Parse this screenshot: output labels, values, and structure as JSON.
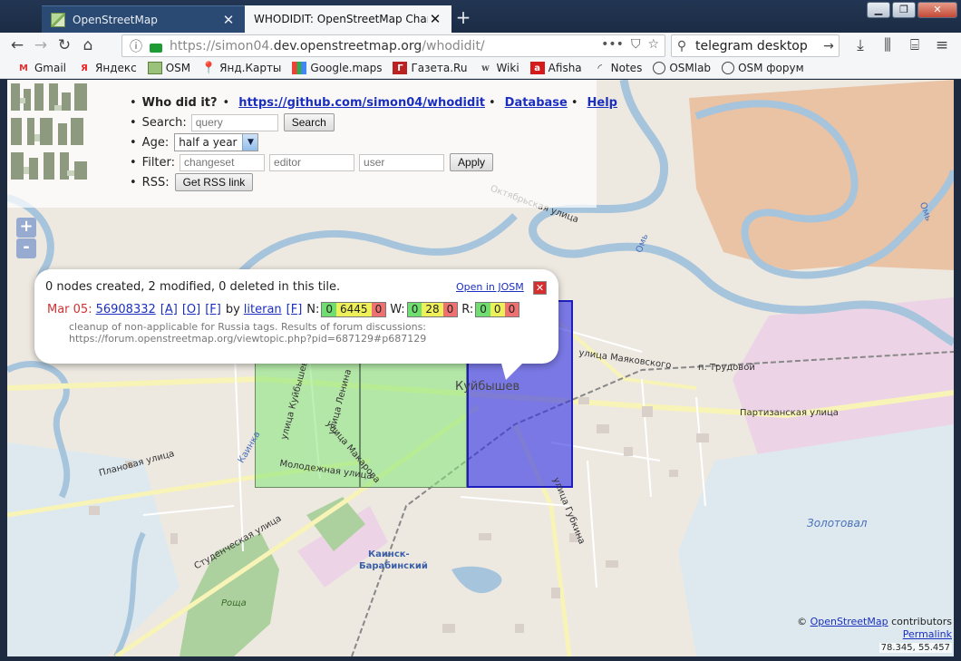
{
  "browser": {
    "tabs": [
      {
        "title": "OpenStreetMap",
        "active": false
      },
      {
        "title": "WHODIDIT: OpenStreetMap Chang",
        "active": true
      }
    ],
    "url": {
      "prefix": "https://simon04.",
      "host": "dev.openstreetmap.org",
      "path": "/whodidit/"
    },
    "search_query": "telegram desktop",
    "bookmarks": [
      {
        "label": "Gmail",
        "icon": "gmail-icon"
      },
      {
        "label": "Яндекс",
        "icon": "yandex-icon"
      },
      {
        "label": "OSM",
        "icon": "osm-icon"
      },
      {
        "label": "Янд.Карты",
        "icon": "map-pin-icon"
      },
      {
        "label": "Google.maps",
        "icon": "google-maps-icon"
      },
      {
        "label": "Газета.Ru",
        "icon": "gazeta-icon"
      },
      {
        "label": "Wiki",
        "icon": "wiki-icon"
      },
      {
        "label": "Afisha",
        "icon": "afisha-icon"
      },
      {
        "label": "Notes",
        "icon": "rss-icon"
      },
      {
        "label": "OSMlab",
        "icon": "globe-icon"
      },
      {
        "label": "OSM форум",
        "icon": "globe-icon"
      }
    ]
  },
  "controls": {
    "whodidit_label": "Who did it?",
    "github_link": "https://github.com/simon04/whodidit",
    "database_link": "Database",
    "help_link": "Help",
    "search_label": "Search:",
    "search_placeholder": "query",
    "search_button": "Search",
    "age_label": "Age:",
    "age_value": "half a year",
    "filter_label": "Filter:",
    "filter_changeset_placeholder": "changeset",
    "filter_editor_placeholder": "editor",
    "filter_user_placeholder": "user",
    "apply_button": "Apply",
    "rss_label": "RSS:",
    "rss_button": "Get RSS link"
  },
  "zoom": {
    "in": "+",
    "out": "-"
  },
  "popup": {
    "summary": "0 nodes created, 2 modified, 0 deleted in this tile.",
    "open_josm": "Open in JOSM",
    "date": "Mar 05:",
    "changeset": "56908332",
    "link_a": "[A]",
    "link_o": "[O]",
    "link_f": "[F]",
    "by": "by",
    "user": "literan",
    "user_f": "[F]",
    "nodes_label": "N:",
    "nodes": [
      "0",
      "6445",
      "0"
    ],
    "ways_label": "W:",
    "ways": [
      "0",
      "28",
      "0"
    ],
    "relations_label": "R:",
    "relations": [
      "0",
      "0",
      "0"
    ],
    "comment_1": "cleanup of non-applicable for Russia tags. Results of forum discussions:",
    "comment_2": "https://forum.openstreetmap.org/viewtopic.php?pid=687129#p687129"
  },
  "map_labels": {
    "kuybyshev": "Куйбышев",
    "lenina": "улица Ленина",
    "kuybysheva": "улица Куйбышева",
    "makarova": "улица Макарова",
    "molodezhnaya": "Молодежная улица",
    "planovaya": "Плановая улица",
    "studencheskaya": "Студенческая улица",
    "gubkina": "улица Губкина",
    "mayakovskogo": "улица Маяковского",
    "partizanskaya": "Партизанская улица",
    "trudovoy": "п. Трудовой",
    "oktyabrskaya": "Октябрьская улица",
    "station_1": "Каинск-",
    "station_2": "Барабинский",
    "zolotoval": "Золотовал",
    "roshcha": "Роща",
    "kainka": "Каинка",
    "om": "Омь",
    "om2": "Омь"
  },
  "credits": {
    "copyright": "©",
    "osm": "OpenStreetMap",
    "contributors": "contributors",
    "permalink": "Permalink",
    "coords": "78.345, 55.457"
  }
}
